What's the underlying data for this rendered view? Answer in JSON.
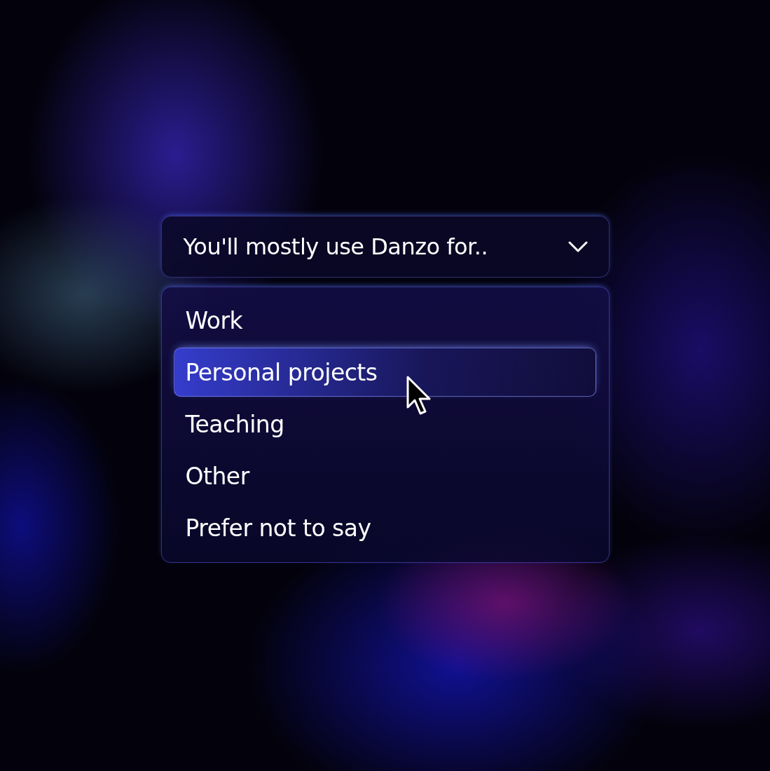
{
  "dropdown": {
    "label": "You'll mostly use Danzo for..",
    "expanded": true
  },
  "options": [
    {
      "label": "Work",
      "selected": false
    },
    {
      "label": "Personal projects",
      "selected": true
    },
    {
      "label": "Teaching",
      "selected": false
    },
    {
      "label": "Other",
      "selected": false
    },
    {
      "label": "Prefer not to say",
      "selected": false
    }
  ]
}
